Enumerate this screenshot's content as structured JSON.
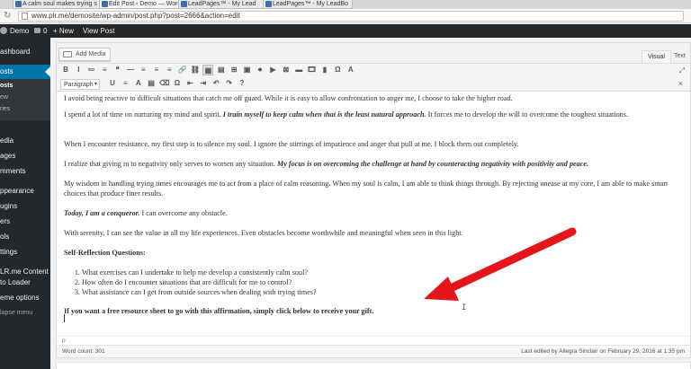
{
  "browser": {
    "tabs": [
      {
        "label": "A calm soul makes trying s"
      },
      {
        "label": "Edit Post ‹ Demo — Word"
      },
      {
        "label": "LeadPages™ - My Lead"
      },
      {
        "label": "LeadPages™ - My LeadBo"
      }
    ],
    "url": "www.plr.me/demosite/wp-admin/post.php?post=2666&action=edit"
  },
  "adminbar": {
    "site": "Demo",
    "comments": "0",
    "new": "+ New",
    "view_post": "View Post"
  },
  "sidebar": {
    "items": [
      {
        "label": "ashboard"
      },
      {
        "label": "osts"
      },
      {
        "label": "edia"
      },
      {
        "label": "ages"
      },
      {
        "label": "mments"
      },
      {
        "label": "ppearance"
      },
      {
        "label": "ugins"
      },
      {
        "label": "ers"
      },
      {
        "label": "ols"
      },
      {
        "label": "ttings"
      },
      {
        "label": "LR.me Content"
      },
      {
        "label": "to Loader"
      },
      {
        "label": "eme options"
      },
      {
        "label": "lapse menu"
      }
    ],
    "posts_sub": [
      {
        "label": "osts"
      },
      {
        "label": "ew"
      },
      {
        "label": "ries"
      }
    ]
  },
  "editor": {
    "add_media": "Add Media",
    "tab_visual": "Visual",
    "tab_text": "Text",
    "format_select": "Paragraph",
    "toolbar_row1": [
      "B",
      "I",
      "≔",
      "≡",
      "❝",
      "—",
      "≡",
      "≡",
      "≡",
      "🔗",
      "⛓",
      "▦",
      "▤",
      "⊞",
      "▣",
      "⏺",
      "▶",
      "⊠",
      "▬",
      "🎞",
      "▮",
      "Ω",
      "A"
    ],
    "toolbar_row2": [
      "U",
      "≡",
      "A",
      "▤",
      "⌫",
      "Ω",
      "⇤",
      "⇥",
      "↶",
      "↷",
      "?"
    ],
    "paragraphs": {
      "p1": "I avoid being reactive to difficult situations that catch me off guard. While it is easy to allow confrontation to anger me, I choose to take the higher road.",
      "p2a": "I spend a lot of time on nurturing my mind and spirit. ",
      "p2b": "I train myself to keep calm when that is the least natural approach.",
      "p2c": " It forces me to develop the will to overcome the toughest situations.",
      "p3": "When I encounter resistance, my first step is to silence my soul. I ignore the stirrings of impatience and anger that pull at me. I block them out completely.",
      "p4a": "I realize that giving in to negativity only serves to worsen any situation. ",
      "p4b": "My focus is on overcoming the challenge at hand by counteracting negativity with positivity and peace.",
      "p5": "My wisdom in handling trying times encourages me to act from a place of calm reasoning. When my soul is calm, I am able to think things through. By rejecting unease at my core, I am able to make smart choices that produce finer results.",
      "p6a": "Today, I am a conqueror.",
      "p6b": " I can overcome any obstacle.",
      "p7": "With serenity, I can see the value in all my life experiences. Even obstacles become worthwhile and meaningful when seen in this light.",
      "heading": "Self-Reflection Questions:",
      "questions": [
        "What exercises can I undertake to help me develop a consistently calm soul?",
        "How often do I encounter situations that are difficult for me to control?",
        "What assistance can I get from outside sources when dealing with trying times?"
      ],
      "cta": "If you want a free resource sheet to go with this affirmation, simply click below to receive your gift."
    },
    "path": "p",
    "word_count": "Word count: 301",
    "last_edited": "Last edited by Allegra Sinclair on February 29, 2016 at 1:35 pm"
  },
  "annotation": {
    "arrow_color": "#e4161a"
  }
}
